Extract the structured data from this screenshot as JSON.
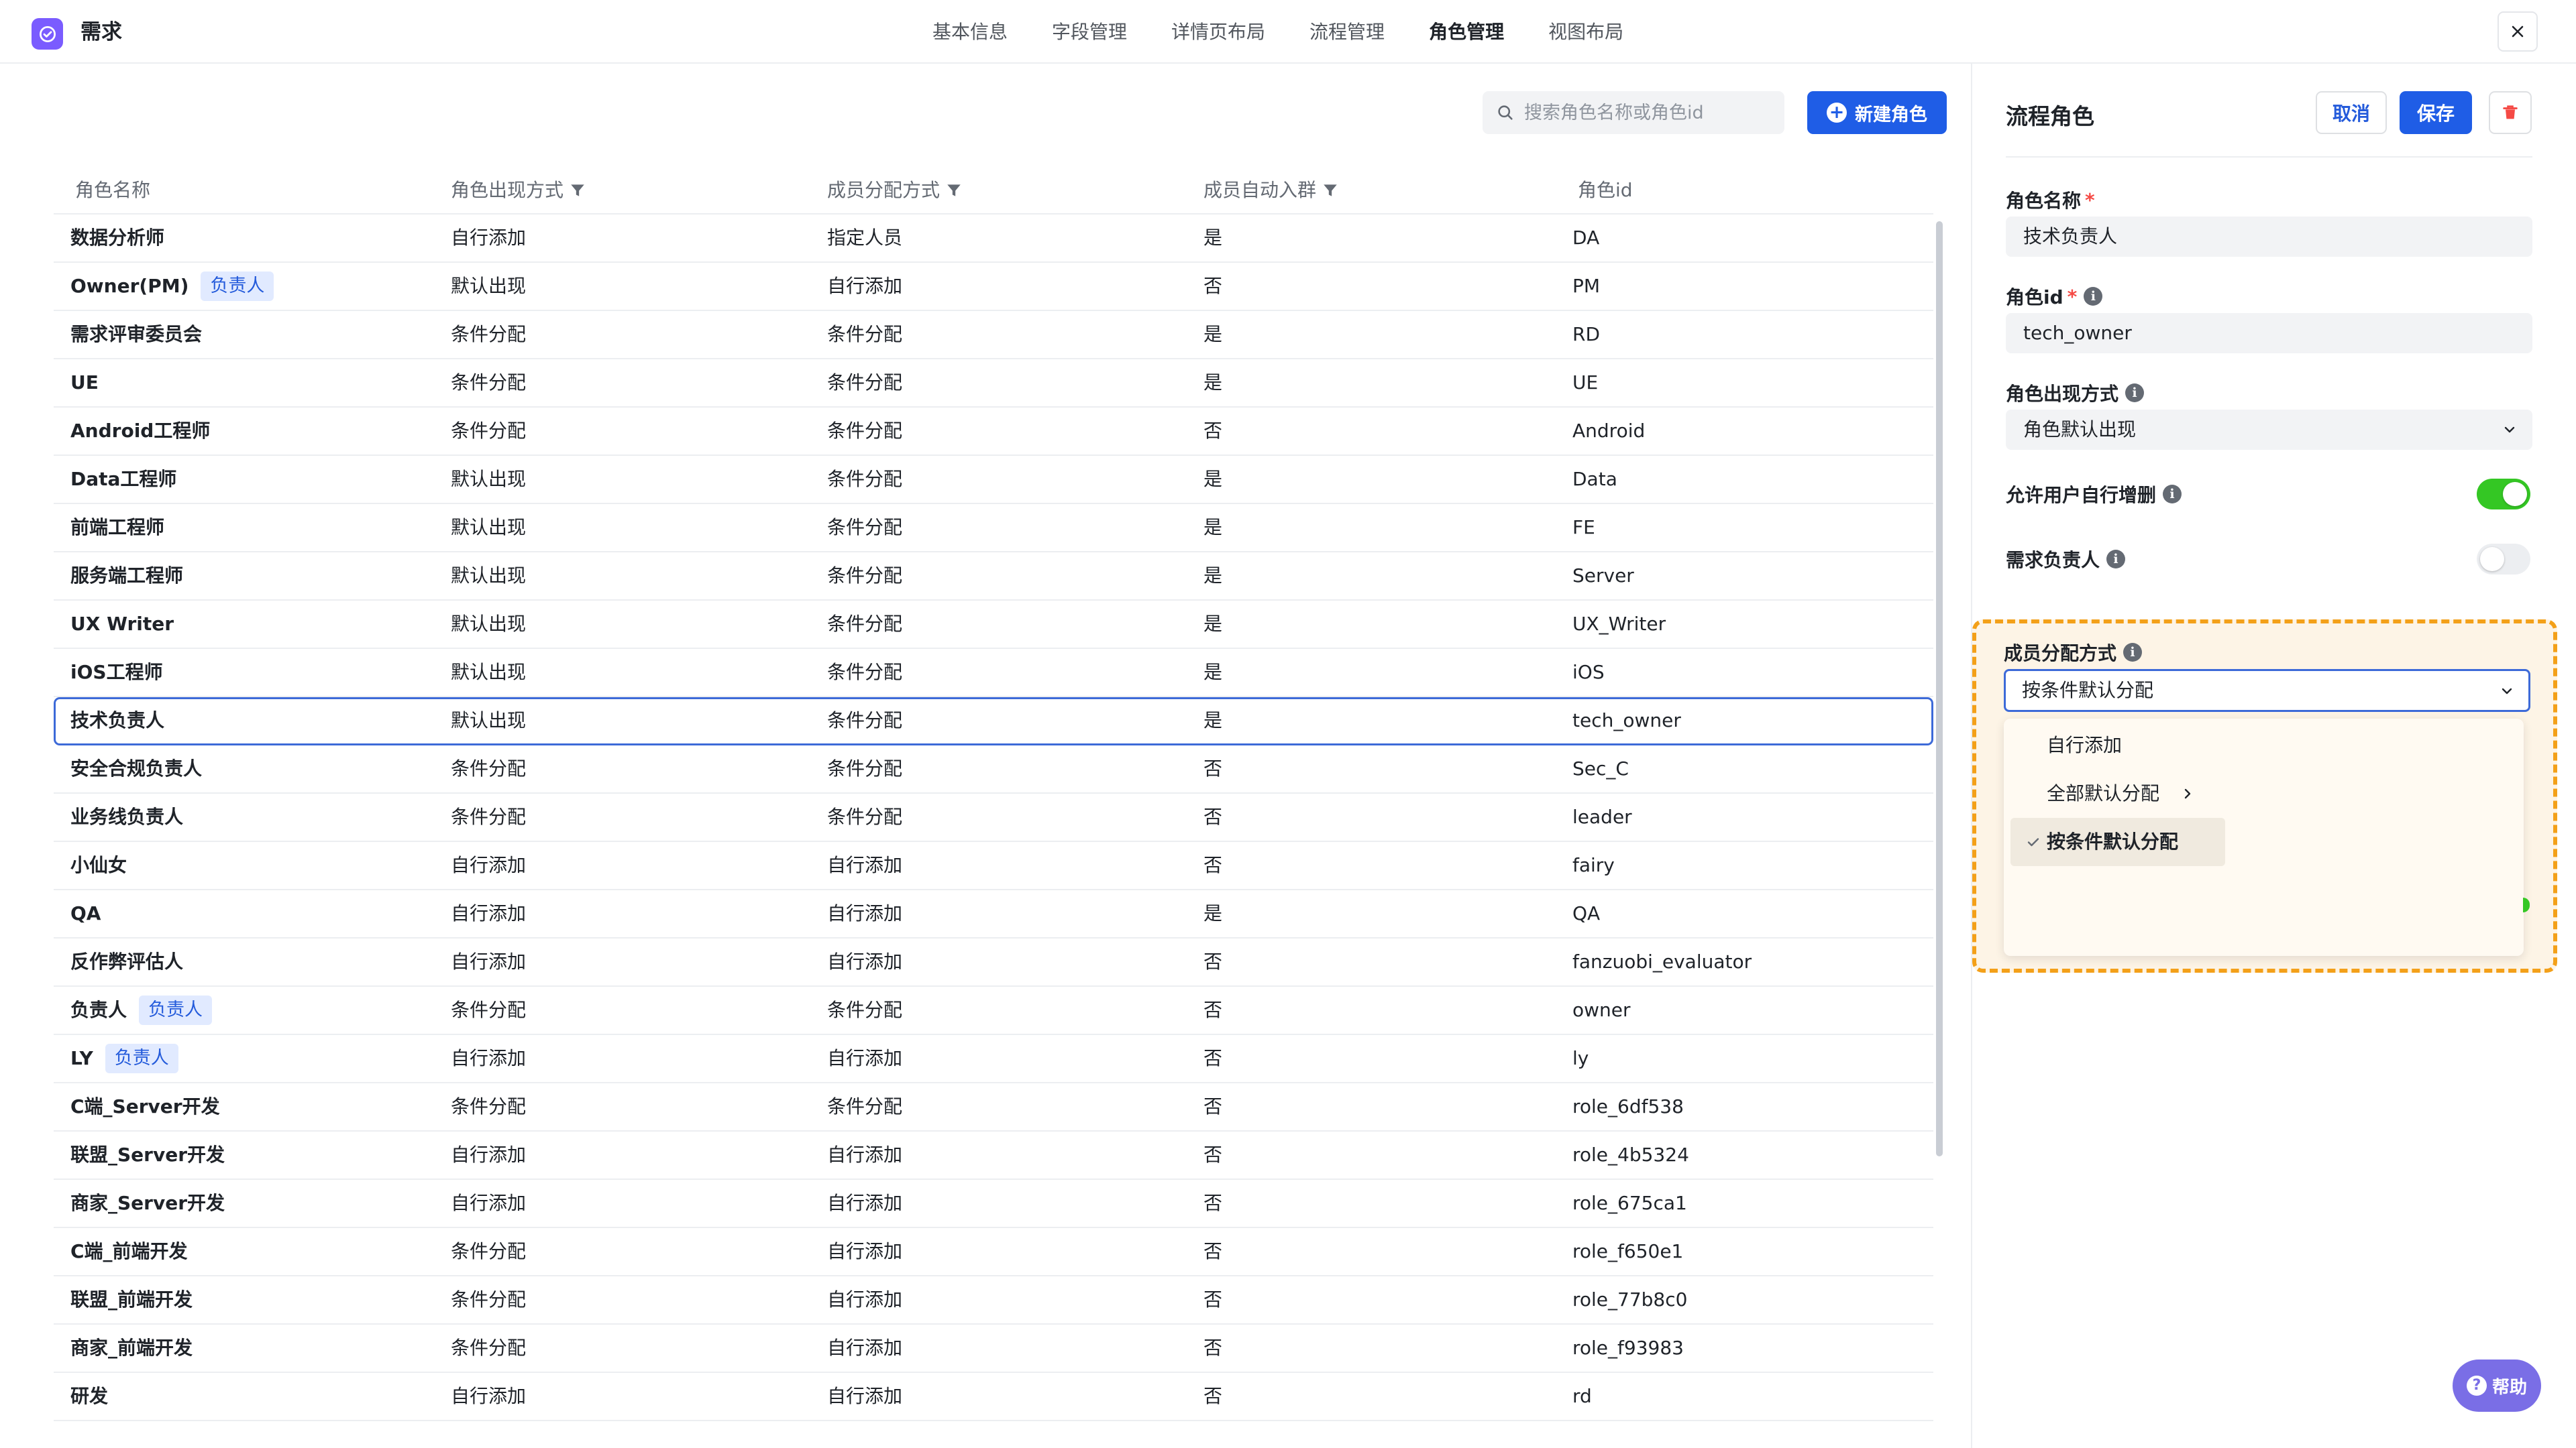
{
  "app": {
    "title": "需求",
    "icon": "app-check-icon",
    "accent": "#7a5cff"
  },
  "nav": {
    "tabs": [
      {
        "label": "基本信息",
        "active": false
      },
      {
        "label": "字段管理",
        "active": false
      },
      {
        "label": "详情页布局",
        "active": false
      },
      {
        "label": "流程管理",
        "active": false
      },
      {
        "label": "角色管理",
        "active": true
      },
      {
        "label": "视图布局",
        "active": false
      }
    ]
  },
  "toolbar": {
    "search_placeholder": "搜索角色名称或角色id",
    "new_role_label": "新建角色",
    "primary_color": "#1f5de6"
  },
  "table": {
    "columns": [
      {
        "label": "角色名称",
        "filter": false
      },
      {
        "label": "角色出现方式",
        "filter": true
      },
      {
        "label": "成员分配方式",
        "filter": true
      },
      {
        "label": "成员自动入群",
        "filter": true
      },
      {
        "label": "角色id",
        "filter": false
      }
    ],
    "rows": [
      {
        "name": "数据分析师",
        "tag": "",
        "appear": "自行添加",
        "assign": "指定人员",
        "auto_join": "是",
        "id": "DA"
      },
      {
        "name": "Owner(PM)",
        "tag": "负责人",
        "appear": "默认出现",
        "assign": "自行添加",
        "auto_join": "否",
        "id": "PM"
      },
      {
        "name": "需求评审委员会",
        "tag": "",
        "appear": "条件分配",
        "assign": "条件分配",
        "auto_join": "是",
        "id": "RD"
      },
      {
        "name": "UE",
        "tag": "",
        "appear": "条件分配",
        "assign": "条件分配",
        "auto_join": "是",
        "id": "UE"
      },
      {
        "name": "Android工程师",
        "tag": "",
        "appear": "条件分配",
        "assign": "条件分配",
        "auto_join": "否",
        "id": "Android"
      },
      {
        "name": "Data工程师",
        "tag": "",
        "appear": "默认出现",
        "assign": "条件分配",
        "auto_join": "是",
        "id": "Data"
      },
      {
        "name": "前端工程师",
        "tag": "",
        "appear": "默认出现",
        "assign": "条件分配",
        "auto_join": "是",
        "id": "FE"
      },
      {
        "name": "服务端工程师",
        "tag": "",
        "appear": "默认出现",
        "assign": "条件分配",
        "auto_join": "是",
        "id": "Server"
      },
      {
        "name": "UX Writer",
        "tag": "",
        "appear": "默认出现",
        "assign": "条件分配",
        "auto_join": "是",
        "id": "UX_Writer"
      },
      {
        "name": "iOS工程师",
        "tag": "",
        "appear": "默认出现",
        "assign": "条件分配",
        "auto_join": "是",
        "id": "iOS"
      },
      {
        "name": "技术负责人",
        "tag": "",
        "appear": "默认出现",
        "assign": "条件分配",
        "auto_join": "是",
        "id": "tech_owner",
        "selected": true
      },
      {
        "name": "安全合规负责人",
        "tag": "",
        "appear": "条件分配",
        "assign": "条件分配",
        "auto_join": "否",
        "id": "Sec_C"
      },
      {
        "name": "业务线负责人",
        "tag": "",
        "appear": "条件分配",
        "assign": "条件分配",
        "auto_join": "否",
        "id": "leader"
      },
      {
        "name": "小仙女",
        "tag": "",
        "appear": "自行添加",
        "assign": "自行添加",
        "auto_join": "否",
        "id": "fairy"
      },
      {
        "name": "QA",
        "tag": "",
        "appear": "自行添加",
        "assign": "自行添加",
        "auto_join": "是",
        "id": "QA"
      },
      {
        "name": "反作弊评估人",
        "tag": "",
        "appear": "自行添加",
        "assign": "自行添加",
        "auto_join": "否",
        "id": "fanzuobi_evaluator"
      },
      {
        "name": "负责人",
        "tag": "负责人",
        "appear": "条件分配",
        "assign": "条件分配",
        "auto_join": "否",
        "id": "owner"
      },
      {
        "name": "LY",
        "tag": "负责人",
        "appear": "自行添加",
        "assign": "自行添加",
        "auto_join": "否",
        "id": "ly"
      },
      {
        "name": "C端_Server开发",
        "tag": "",
        "appear": "条件分配",
        "assign": "条件分配",
        "auto_join": "否",
        "id": "role_6df538"
      },
      {
        "name": "联盟_Server开发",
        "tag": "",
        "appear": "自行添加",
        "assign": "自行添加",
        "auto_join": "否",
        "id": "role_4b5324"
      },
      {
        "name": "商家_Server开发",
        "tag": "",
        "appear": "自行添加",
        "assign": "自行添加",
        "auto_join": "否",
        "id": "role_675ca1"
      },
      {
        "name": "C端_前端开发",
        "tag": "",
        "appear": "条件分配",
        "assign": "自行添加",
        "auto_join": "否",
        "id": "role_f650e1"
      },
      {
        "name": "联盟_前端开发",
        "tag": "",
        "appear": "条件分配",
        "assign": "自行添加",
        "auto_join": "否",
        "id": "role_77b8c0"
      },
      {
        "name": "商家_前端开发",
        "tag": "",
        "appear": "条件分配",
        "assign": "自行添加",
        "auto_join": "否",
        "id": "role_f93983"
      },
      {
        "name": "研发",
        "tag": "",
        "appear": "自行添加",
        "assign": "自行添加",
        "auto_join": "否",
        "id": "rd"
      }
    ]
  },
  "panel": {
    "title": "流程角色",
    "cancel_label": "取消",
    "save_label": "保存",
    "role_name_label": "角色名称",
    "role_name_value": "技术负责人",
    "role_id_label": "角色id",
    "role_id_value": "tech_owner",
    "appear_label": "角色出现方式",
    "appear_value": "角色默认出现",
    "allow_edit_label": "允许用户自行增删",
    "allow_edit_on": true,
    "req_owner_label": "需求负责人",
    "req_owner_on": false,
    "assign_label": "成员分配方式",
    "assign_value": "按条件默认分配",
    "assign_options": [
      {
        "label": "自行添加",
        "has_submenu": false,
        "selected": false
      },
      {
        "label": "全部默认分配",
        "has_submenu": true,
        "selected": false
      },
      {
        "label": "按条件默认分配",
        "has_submenu": false,
        "selected": true
      }
    ],
    "highlight_color": "#f3a019",
    "toggle_on_color": "#34c724"
  },
  "help": {
    "label": "帮助"
  }
}
